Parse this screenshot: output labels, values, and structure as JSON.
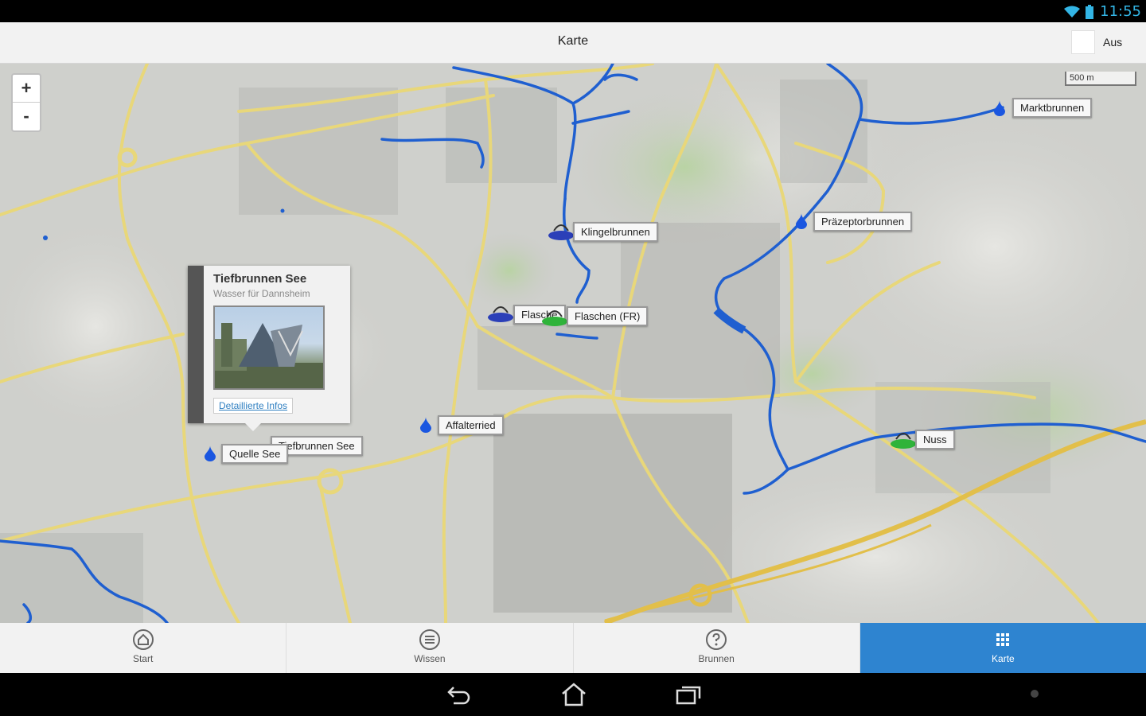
{
  "status": {
    "time": "11:55",
    "wifi_icon": "wifi-icon",
    "battery_icon": "battery-icon"
  },
  "actionbar": {
    "title": "Karte",
    "toggle_label": "Aus"
  },
  "map": {
    "scale_label": "500 m",
    "zoom_in": "+",
    "zoom_out": "-",
    "labels": {
      "marktbrunnen": "Marktbrunnen",
      "klingelbrunnen": "Klingelbrunnen",
      "praezeptorbrunnen": "Präzeptorbrunnen",
      "flasche": "Flasche",
      "flaschen_fr": "Flaschen (FR)",
      "affalterried": "Affalterried",
      "tiefbrunnen_see": "Tiefbrunnen See",
      "quelle_see": "Quelle See",
      "nuss": "Nuss"
    },
    "popup": {
      "title": "Tiefbrunnen See",
      "subtitle": "Wasser für Dannsheim",
      "link": "Detaillierte Infos"
    }
  },
  "tabs": [
    {
      "label": "Start",
      "icon": "home-icon"
    },
    {
      "label": "Wissen",
      "icon": "list-icon"
    },
    {
      "label": "Brunnen",
      "icon": "help-icon"
    },
    {
      "label": "Karte",
      "icon": "grid-icon",
      "active": true
    }
  ],
  "navbar": {
    "back_icon": "back-icon",
    "home_icon": "home-nav-icon",
    "recents_icon": "recents-icon"
  },
  "colors": {
    "accent": "#2e84d0",
    "water": "#1f5fd0",
    "road": "#e8d77a"
  }
}
